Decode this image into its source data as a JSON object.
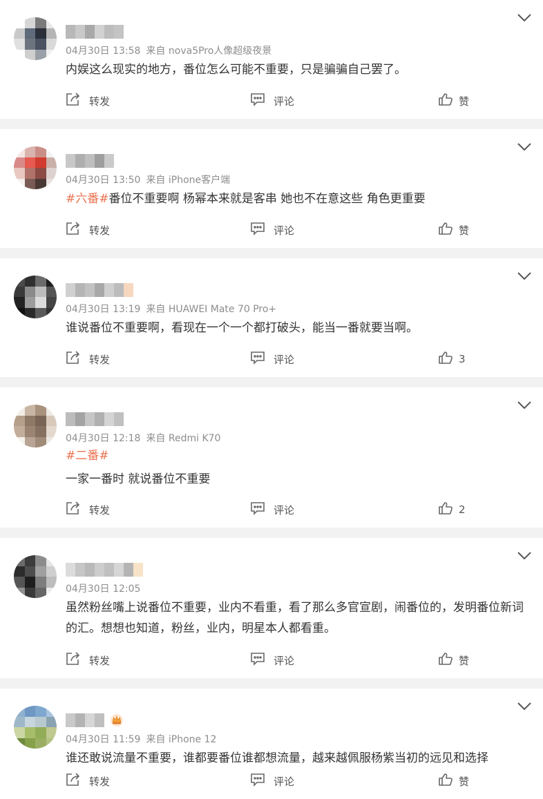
{
  "labels": {
    "forward": "转发",
    "comment": "评论"
  },
  "comments": [
    {
      "time": "04月30日 13:58",
      "source": "来自 nova5Pro人像超级夜景",
      "tag": "",
      "text": [
        "内娱这么现实的地方，番位怎么可能不重要，只是骗骗自己罢了。"
      ],
      "likes": "赞",
      "vip": false,
      "avatar_colors": [
        "#ffffff",
        "#d6d6d6",
        "#7a7a7a",
        "#e8e8e8",
        "#c9c9c9",
        "#5f6a7a",
        "#2a2f3a",
        "#b5b5b5",
        "#e0e0e0",
        "#6d7480",
        "#4a5262",
        "#d9d9d9",
        "#ffffff",
        "#cfcfcf",
        "#9aa0a8",
        "#f0f0f0"
      ],
      "name_colors": [
        "#b8b8b8",
        "#c9c9c9",
        "#a9a9a9",
        "#d2d2d2",
        "#bdbdbd",
        "#c4c4c4"
      ]
    },
    {
      "time": "04月30日 13:50",
      "source": "来自 iPhone客户端",
      "tag": "#六番#",
      "text": [
        "番位不重要啊 杨幂本来就是客串 她也不在意这些 角色更重要"
      ],
      "likes": "赞",
      "vip": false,
      "avatar_colors": [
        "#f3e6e2",
        "#d9b3ad",
        "#c98f87",
        "#f2f2f2",
        "#d88a88",
        "#e75a4f",
        "#d23b30",
        "#c9b0a8",
        "#e8c8c0",
        "#b0726a",
        "#8c4b45",
        "#ddd2cf",
        "#f5f0ee",
        "#7a5a55",
        "#4a3834",
        "#e9e2e0"
      ],
      "name_colors": [
        "#c8c8c8",
        "#aeaeae",
        "#bfbfbf",
        "#9e9e9e",
        "#cacaca"
      ]
    },
    {
      "time": "04月30日 13:19",
      "source": "来自 HUAWEI Mate 70 Pro+",
      "tag": "",
      "text": [
        "谁说番位不重要啊，看现在一个一个都打破头，能当一番就要当啊。"
      ],
      "likes": "3",
      "vip": false,
      "avatar_colors": [
        "#4a4a4a",
        "#2f2f2f",
        "#6b6b6b",
        "#1f1f1f",
        "#3a3a3a",
        "#8a8a8a",
        "#bdbdbd",
        "#555555",
        "#222222",
        "#9c9c9c",
        "#dcdcdc",
        "#444444",
        "#111111",
        "#2a2a2a",
        "#5a5a5a",
        "#333333"
      ],
      "name_colors": [
        "#d0d0d0",
        "#b5b5b5",
        "#c2c2c2",
        "#a8a8a8",
        "#cfcfcf",
        "#bcbcbc",
        "#f6d7c0"
      ]
    },
    {
      "time": "04月30日 12:18",
      "source": "来自 Redmi K70",
      "tag": "#二番#",
      "text": [
        "一家一番时 就说番位不重要"
      ],
      "likes": "2",
      "vip": false,
      "avatar_colors": [
        "#f2ece6",
        "#c9b5a3",
        "#a8917d",
        "#efe9e3",
        "#b59e8a",
        "#8e7866",
        "#7a6455",
        "#d8c9bb",
        "#c2ad9a",
        "#9b8472",
        "#86705f",
        "#e3d8cd",
        "#f5f1ec",
        "#b7a494",
        "#a08b79",
        "#eee8e2"
      ],
      "name_colors": [
        "#bcbcbc",
        "#a3a3a3",
        "#c6c6c6",
        "#b0b0b0",
        "#d4d4d4",
        "#c0c0c0"
      ]
    },
    {
      "time": "04月30日 12:05",
      "source": "",
      "tag": "",
      "text": [
        "虽然粉丝嘴上说番位不重要，业内不看重，看了那么多官宣剧，闹番位的，发明番位新词的汇。想想也知道，粉丝，业内，明星本人都看重。"
      ],
      "likes": "赞",
      "vip": false,
      "avatar_colors": [
        "#6a6a6a",
        "#3c3c3c",
        "#8c8c8c",
        "#e6e6e6",
        "#2c2c2c",
        "#4d4d4d",
        "#a0a0a0",
        "#cfcfcf",
        "#555555",
        "#1e1e1e",
        "#7d7d7d",
        "#bdbdbd",
        "#909090",
        "#3a3a3a",
        "#666666",
        "#eeeeee"
      ],
      "name_colors": [
        "#dcdcdc",
        "#c6c6c6",
        "#b9b9b9",
        "#cdcdcd",
        "#c0c0c0",
        "#d6d6d6",
        "#b4b4b4",
        "#f8e3c8"
      ]
    },
    {
      "time": "04月30日 11:59",
      "source": "来自 iPhone 12",
      "tag": "",
      "text": [
        "谁还敢说流量不重要，谁都要番位谁都想流量，越来越佩服杨紫当初的远见和选择"
      ],
      "likes": "赞",
      "vip": true,
      "avatar_colors": [
        "#8fb0cf",
        "#6e97c2",
        "#7fa8d0",
        "#a9c4de",
        "#9fb8c9",
        "#c7d6de",
        "#b8c9cf",
        "#8aa3b3",
        "#cbd6a4",
        "#a7bd6a",
        "#92ad57",
        "#c0c98f",
        "#6f8a3c",
        "#87a14b",
        "#9aaf63",
        "#b2c280"
      ],
      "name_colors": [
        "#c9c9c9",
        "#b3b3b3",
        "#d6d6d6",
        "#bfbfbf"
      ]
    }
  ]
}
